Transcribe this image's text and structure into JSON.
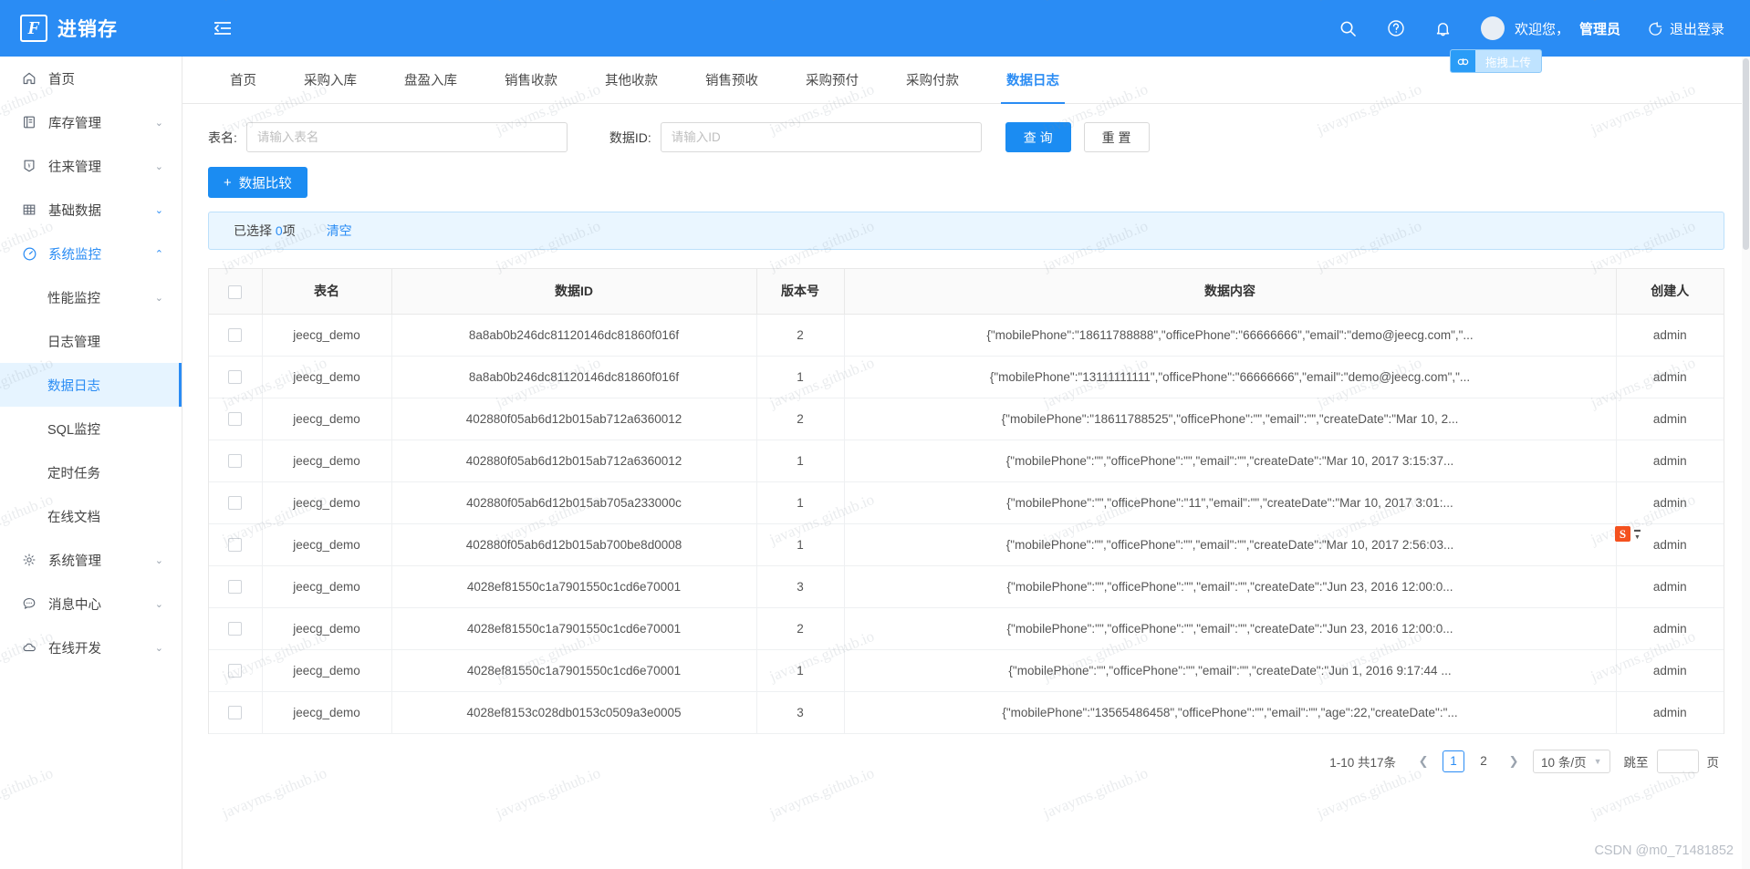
{
  "header": {
    "logo_letter": "F",
    "app_title": "进销存",
    "collapse_icon": "menu-fold-icon",
    "search_icon": "search-icon",
    "help_icon": "question-circle-icon",
    "bell_icon": "bell-icon",
    "avatar_icon": "user-avatar",
    "welcome_prefix": "欢迎您，",
    "welcome_user": "管理员",
    "logout_label": "退出登录",
    "logout_icon": "logout-icon"
  },
  "upload_widget": {
    "icon": "cloud-upload-icon",
    "label": "拖拽上传"
  },
  "sidebar": {
    "items": [
      {
        "label": "首页",
        "icon": "home-icon",
        "arrow": "",
        "level": 0,
        "state": ""
      },
      {
        "label": "库存管理",
        "icon": "inventory-icon",
        "arrow": "⌄",
        "level": 0,
        "state": ""
      },
      {
        "label": "往来管理",
        "icon": "currency-icon",
        "arrow": "⌄",
        "level": 0,
        "state": ""
      },
      {
        "label": "基础数据",
        "icon": "table-icon",
        "arrow": "⌄",
        "level": 0,
        "state": "arrow-blue"
      },
      {
        "label": "系统监控",
        "icon": "dashboard-icon",
        "arrow": "⌃",
        "level": 0,
        "state": "active-parent"
      },
      {
        "label": "性能监控",
        "icon": "",
        "arrow": "⌄",
        "level": 1,
        "state": ""
      },
      {
        "label": "日志管理",
        "icon": "",
        "arrow": "",
        "level": 1,
        "state": ""
      },
      {
        "label": "数据日志",
        "icon": "",
        "arrow": "",
        "level": 1,
        "state": "selected"
      },
      {
        "label": "SQL监控",
        "icon": "",
        "arrow": "",
        "level": 1,
        "state": ""
      },
      {
        "label": "定时任务",
        "icon": "",
        "arrow": "",
        "level": 1,
        "state": ""
      },
      {
        "label": "在线文档",
        "icon": "",
        "arrow": "",
        "level": 1,
        "state": ""
      },
      {
        "label": "系统管理",
        "icon": "gear-icon",
        "arrow": "⌄",
        "level": 0,
        "state": ""
      },
      {
        "label": "消息中心",
        "icon": "message-icon",
        "arrow": "⌄",
        "level": 0,
        "state": ""
      },
      {
        "label": "在线开发",
        "icon": "cloud-icon",
        "arrow": "⌄",
        "level": 0,
        "state": ""
      }
    ]
  },
  "tabs": [
    {
      "label": "首页",
      "active": false
    },
    {
      "label": "采购入库",
      "active": false
    },
    {
      "label": "盘盈入库",
      "active": false
    },
    {
      "label": "销售收款",
      "active": false
    },
    {
      "label": "其他收款",
      "active": false
    },
    {
      "label": "销售预收",
      "active": false
    },
    {
      "label": "采购预付",
      "active": false
    },
    {
      "label": "采购付款",
      "active": false
    },
    {
      "label": "数据日志",
      "active": true
    }
  ],
  "search": {
    "table_name_label": "表名:",
    "table_name_value": "",
    "table_name_placeholder": "请输入表名",
    "data_id_label": "数据ID:",
    "data_id_value": "",
    "data_id_placeholder": "请输入ID",
    "query_label": "查 询",
    "reset_label": "重 置"
  },
  "toolbar": {
    "compare_label": "数据比较",
    "plus_icon": "plus-icon"
  },
  "selection": {
    "prefix": "已选择",
    "count": "0",
    "suffix": "项",
    "clear_label": "清空"
  },
  "table": {
    "headers": {
      "checkbox": "",
      "table_name": "表名",
      "data_id": "数据ID",
      "version": "版本号",
      "content": "数据内容",
      "creator": "创建人"
    },
    "rows": [
      {
        "table_name": "jeecg_demo",
        "data_id": "8a8ab0b246dc81120146dc81860f016f",
        "version": "2",
        "content": "{\"mobilePhone\":\"18611788888\",\"officePhone\":\"66666666\",\"email\":\"demo@jeecg.com\",\"...",
        "creator": "admin"
      },
      {
        "table_name": "jeecg_demo",
        "data_id": "8a8ab0b246dc81120146dc81860f016f",
        "version": "1",
        "content": "{\"mobilePhone\":\"13111111111\",\"officePhone\":\"66666666\",\"email\":\"demo@jeecg.com\",\"...",
        "creator": "admin"
      },
      {
        "table_name": "jeecg_demo",
        "data_id": "402880f05ab6d12b015ab712a6360012",
        "version": "2",
        "content": "{\"mobilePhone\":\"18611788525\",\"officePhone\":\"\",\"email\":\"\",\"createDate\":\"Mar 10, 2...",
        "creator": "admin"
      },
      {
        "table_name": "jeecg_demo",
        "data_id": "402880f05ab6d12b015ab712a6360012",
        "version": "1",
        "content": "{\"mobilePhone\":\"\",\"officePhone\":\"\",\"email\":\"\",\"createDate\":\"Mar 10, 2017 3:15:37...",
        "creator": "admin"
      },
      {
        "table_name": "jeecg_demo",
        "data_id": "402880f05ab6d12b015ab705a233000c",
        "version": "1",
        "content": "{\"mobilePhone\":\"\",\"officePhone\":\"11\",\"email\":\"\",\"createDate\":\"Mar 10, 2017 3:01:...",
        "creator": "admin"
      },
      {
        "table_name": "jeecg_demo",
        "data_id": "402880f05ab6d12b015ab700be8d0008",
        "version": "1",
        "content": "{\"mobilePhone\":\"\",\"officePhone\":\"\",\"email\":\"\",\"createDate\":\"Mar 10, 2017 2:56:03...",
        "creator": "admin"
      },
      {
        "table_name": "jeecg_demo",
        "data_id": "4028ef81550c1a7901550c1cd6e70001",
        "version": "3",
        "content": "{\"mobilePhone\":\"\",\"officePhone\":\"\",\"email\":\"\",\"createDate\":\"Jun 23, 2016 12:00:0...",
        "creator": "admin"
      },
      {
        "table_name": "jeecg_demo",
        "data_id": "4028ef81550c1a7901550c1cd6e70001",
        "version": "2",
        "content": "{\"mobilePhone\":\"\",\"officePhone\":\"\",\"email\":\"\",\"createDate\":\"Jun 23, 2016 12:00:0...",
        "creator": "admin"
      },
      {
        "table_name": "jeecg_demo",
        "data_id": "4028ef81550c1a7901550c1cd6e70001",
        "version": "1",
        "content": "{\"mobilePhone\":\"\",\"officePhone\":\"\",\"email\":\"\",\"createDate\":\"Jun 1, 2016 9:17:44 ...",
        "creator": "admin"
      },
      {
        "table_name": "jeecg_demo",
        "data_id": "4028ef8153c028db0153c0509a3e0005",
        "version": "3",
        "content": "{\"mobilePhone\":\"13565486458\",\"officePhone\":\"\",\"email\":\"\",\"age\":22,\"createDate\":\"...",
        "creator": "admin"
      }
    ]
  },
  "pagination": {
    "range_text": "1-10 共17条",
    "prev_icon": "chevron-left-icon",
    "next_icon": "chevron-right-icon",
    "pages": [
      "1",
      "2"
    ],
    "current_page": "1",
    "page_size_label": "10 条/页",
    "jump_label": "跳至",
    "jump_value": "",
    "jump_suffix": "页"
  },
  "watermark": {
    "text": "javayms.github.io",
    "csdn": "CSDN @m0_71481852"
  },
  "ime": {
    "badge_letter": "S"
  },
  "colors": {
    "brand": "#2a8cf4",
    "primary_button": "#1b8cf2",
    "selected_menu_bg": "#e6f4ff",
    "alert_bg": "#eaf6ff"
  }
}
